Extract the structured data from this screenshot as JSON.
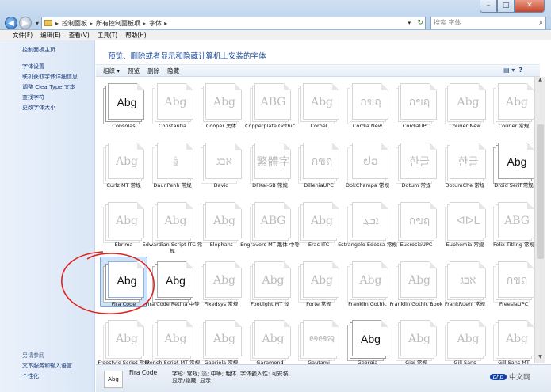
{
  "window": {
    "buttons": {
      "minimize": "–",
      "maximize": "□",
      "close": "✕"
    }
  },
  "address": {
    "crumbs": [
      "控制面板",
      "所有控制面板项",
      "字体"
    ],
    "separator": "▸",
    "refresh": "↻"
  },
  "search": {
    "placeholder": "搜索 字体",
    "icon": "search-icon"
  },
  "menu": [
    "文件(F)",
    "编辑(E)",
    "查看(V)",
    "工具(T)",
    "帮助(H)"
  ],
  "sidebar": {
    "links": [
      "控制面板主页",
      "字体设置",
      "联机获取字体详细信息",
      "调整 ClearType 文本",
      "查找字符",
      "更改字体大小"
    ],
    "see_also_heading": "另请参阅",
    "see_also": [
      "文本服务和输入语言",
      "个性化"
    ]
  },
  "page_title": "预览、删除或者显示和隐藏计算机上安装的字体",
  "toolbar": {
    "organize": "组织 ▾",
    "preview": "预览",
    "delete": "删除",
    "hide": "隐藏",
    "view_icon": "view-icon",
    "help": "?"
  },
  "fonts": [
    {
      "name": "Consolas",
      "sample": "Abg",
      "dark": true
    },
    {
      "name": "Constantia",
      "sample": "Abg",
      "dark": false
    },
    {
      "name": "Cooper 黑体",
      "sample": "Abg",
      "dark": false
    },
    {
      "name": "Copperplate Gothic",
      "sample": "ABG",
      "dark": false
    },
    {
      "name": "Corbel",
      "sample": "Abg",
      "dark": false
    },
    {
      "name": "Cordia New",
      "sample": "กขฤ",
      "dark": false
    },
    {
      "name": "CordiaUPC",
      "sample": "กขฤ",
      "dark": false
    },
    {
      "name": "Courier New",
      "sample": "Abg",
      "dark": false
    },
    {
      "name": "Courier 常规",
      "sample": "Abg",
      "dark": false
    },
    {
      "name": "Curlz MT 常规",
      "sample": "Abg",
      "dark": false
    },
    {
      "name": "DaunPenh 常规",
      "sample": "ឆ្នំ",
      "dark": false
    },
    {
      "name": "David",
      "sample": "אבג",
      "dark": false
    },
    {
      "name": "DFKai-SB 常规",
      "sample": "繁體字",
      "dark": false
    },
    {
      "name": "DilleniaUPC",
      "sample": "กขฤ",
      "dark": false
    },
    {
      "name": "DokChampa 常规",
      "sample": "ຢວ",
      "dark": false
    },
    {
      "name": "Dotum 常规",
      "sample": "한글",
      "dark": false
    },
    {
      "name": "DotumChe 常规",
      "sample": "한글",
      "dark": false
    },
    {
      "name": "Droid Serif 常规",
      "sample": "Abg",
      "dark": true
    },
    {
      "name": "Ebrima",
      "sample": "Abg",
      "dark": false
    },
    {
      "name": "Edwardian Script ITC 常规",
      "sample": "Abg",
      "dark": false
    },
    {
      "name": "Elephant",
      "sample": "Abg",
      "dark": false
    },
    {
      "name": "Engravers MT 黑体 中等",
      "sample": "ABG",
      "dark": false
    },
    {
      "name": "Eras ITC",
      "sample": "Abg",
      "dark": false
    },
    {
      "name": "Estrangelo Edessa 常规",
      "sample": "ܐܒܓ",
      "dark": false
    },
    {
      "name": "EucrosiaUPC",
      "sample": "กขฤ",
      "dark": false
    },
    {
      "name": "Euphemia 常规",
      "sample": "ᐊᐅᒪ",
      "dark": false
    },
    {
      "name": "Felix Titling 常规",
      "sample": "ABG",
      "dark": false
    },
    {
      "name": "Fira Code",
      "sample": "Abg",
      "dark": true
    },
    {
      "name": "Fira Code Retina 中等",
      "sample": "Abg",
      "dark": true
    },
    {
      "name": "Fixedsys 常规",
      "sample": "Abg",
      "dark": false
    },
    {
      "name": "Footlight MT 淡",
      "sample": "Abg",
      "dark": false
    },
    {
      "name": "Forte 常规",
      "sample": "Abg",
      "dark": false
    },
    {
      "name": "Franklin Gothic",
      "sample": "Abg",
      "dark": false
    },
    {
      "name": "Franklin Gothic Book",
      "sample": "Abg",
      "dark": false
    },
    {
      "name": "FrankRuehl 常规",
      "sample": "אבג",
      "dark": false
    },
    {
      "name": "FreesiaUPC",
      "sample": "กขฤ",
      "dark": false
    },
    {
      "name": "Freestyle Script 常规",
      "sample": "Abg",
      "dark": false
    },
    {
      "name": "French Script MT 常规",
      "sample": "Abg",
      "dark": false
    },
    {
      "name": "Gabriola 常规",
      "sample": "Abg",
      "dark": false
    },
    {
      "name": "Garamond",
      "sample": "Abg",
      "dark": false
    },
    {
      "name": "Gautami",
      "sample": "అఆఇ",
      "dark": false
    },
    {
      "name": "Georgia",
      "sample": "Abg",
      "dark": true
    },
    {
      "name": "Gigi 常规",
      "sample": "Abg",
      "dark": false
    },
    {
      "name": "Gill Sans",
      "sample": "Abg",
      "dark": false
    },
    {
      "name": "Gill Sans MT",
      "sample": "Abg",
      "dark": false
    }
  ],
  "selected_font": "Fira Code",
  "status": {
    "name": "Fira Code",
    "thumb": "Abg",
    "style": "字形: 常规; 淡; 中等; 粗体",
    "visibility": "显示/隐藏: 显示",
    "embeddable": "字体嵌入性: 可安装",
    "watermark_logo": "php",
    "watermark_text": "中文网"
  }
}
